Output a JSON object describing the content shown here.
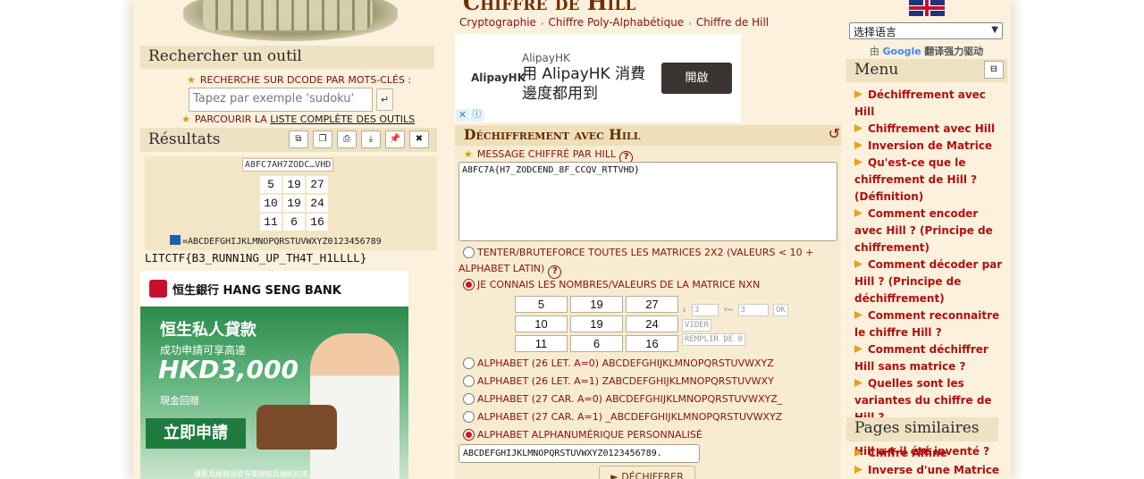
{
  "header": {
    "title": "Chiffre de Hill",
    "breadcrumbs": [
      "Cryptographie",
      "Chiffre Poly-Alphabétique",
      "Chiffre de Hill"
    ]
  },
  "search": {
    "heading": "Rechercher un outil",
    "keyword_label": "Recherche sur dCode par mots-clés :",
    "placeholder": "Tapez par exemple 'sudoku'",
    "submit_icon": "enter-icon",
    "browse_prefix": "Parcourir la",
    "browse_link": "liste complète des outils"
  },
  "results": {
    "heading": "Résultats",
    "tool_icons": [
      "copy-icon",
      "duplicate-icon",
      "print-icon",
      "download-icon",
      "pin-icon",
      "close-icon"
    ],
    "cipher_short": "A8FC7AH7ZODC…VHD",
    "matrix": [
      [
        "5",
        "19",
        "27"
      ],
      [
        "10",
        "19",
        "24"
      ],
      [
        "11",
        "6",
        "16"
      ]
    ],
    "alphabet": "=ABCDEFGHIJKLMNOPQRSTUVWXYZ0123456789",
    "plaintext": "LITCTF{B3_RUNN1NG_UP_TH4T_H1LLLL}"
  },
  "ad_left": {
    "brand": "恒生銀行 HANG SENG BANK",
    "headline": "恒生私人貸款",
    "subline": "成功申請可享高達",
    "amount": "HKD3,000",
    "note": "現金回贈",
    "cta": "立即申請",
    "fine_print": "優惠及服務須受有關條款及細則約束。"
  },
  "ad_mid": {
    "logo": "AlipayHK",
    "small": "AlipayHK",
    "headline_1": "用 AlipayHK 消費",
    "headline_2": "邊度都用到",
    "button": "開啟"
  },
  "form": {
    "heading": "Déchiffrement avec Hill",
    "message_label": "Message chiffré par Hill",
    "message_value": "A8FC7A{H7_ZODCEND_8F_CCQV_RTTVHD}",
    "opt_bruteforce_1": "Tenter/Bruteforce toutes les matrices 2x2 (valeurs < 10 +",
    "opt_bruteforce_2": "alphabet latin)",
    "opt_known": "Je connais les nombres/valeurs de la matrice NxN",
    "matrix": [
      [
        "5",
        "19",
        "27"
      ],
      [
        "10",
        "19",
        "24"
      ],
      [
        "11",
        "6",
        "16"
      ]
    ],
    "size_rows": "3",
    "size_cols": "3",
    "ok": "OK",
    "clear": "VIDER",
    "fill_zero": "REMPLIR DE 0",
    "alphabets": [
      "ALPHABET (26 LET. A=0) ABCDEFGHIJKLMNOPQRSTUVWXYZ",
      "ALPHABET (26 LET. A=1) ZABCDEFGHIJKLMNOPQRSTUVWXY",
      "ALPHABET (27 CAR. A=0) ABCDEFGHIJKLMNOPQRSTUVWXYZ_",
      "ALPHABET (27 CAR. A=1) _ABCDEFGHIJKLMNOPQRSTUVWXYZ",
      "ALPHABET ALPHANUMÉRIQUE PERSONNALISÉ"
    ],
    "custom_alphabet": "ABCDEFGHIJKLMNOPQRSTUVWXYZ0123456789.",
    "decode_button": "► DÉCHIFFRER"
  },
  "sidebar": {
    "lang_select": "选择语言",
    "powered_prefix": "由",
    "powered_google": "Google",
    "powered_suffix": "翻译强力驱动",
    "menu_heading": "Menu",
    "menu_items": [
      "Déchiffrement avec Hill",
      "Chiffrement avec Hill",
      "Inversion de Matrice",
      "Qu'est-ce que le chiffrement de Hill ? (Définition)",
      "Comment encoder avec Hill ? (Principe de chiffrement)",
      "Comment décoder par Hill ? (Principe de déchiffrement)",
      "Comment reconnaitre le chiffre Hill ?",
      "Comment déchiffrer Hill sans matrice ?",
      "Quelles sont les variantes du chiffre de Hill ?",
      "Quand le chiffre de Hill a-t-il été inventé ?"
    ],
    "similar_heading": "Pages similaires",
    "similar_items": [
      "Chiffre Affine",
      "Inverse d'une Matrice"
    ]
  },
  "colors": {
    "page_bg": "#fbf1dc",
    "section_header": "#efe2c3",
    "link_red": "#b01010",
    "title_brown": "#6f2f05"
  }
}
